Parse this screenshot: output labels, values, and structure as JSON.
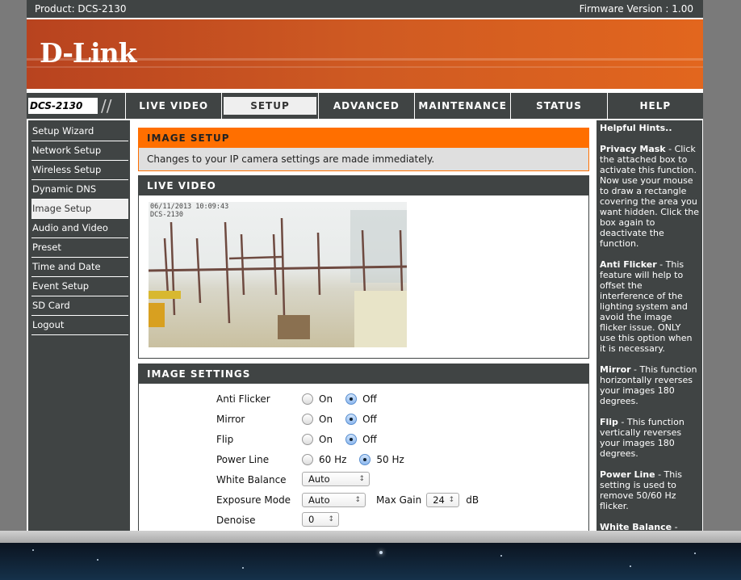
{
  "topbar": {
    "product": "Product: DCS-2130",
    "firmware": "Firmware Version : 1.00"
  },
  "logo": "D-Link",
  "nav": {
    "model": "DCS-2130",
    "tabs": [
      "LIVE VIDEO",
      "SETUP",
      "ADVANCED",
      "MAINTENANCE",
      "STATUS",
      "HELP"
    ],
    "active": "SETUP"
  },
  "sidebar": {
    "items": [
      "Setup Wizard",
      "Network Setup",
      "Wireless Setup",
      "Dynamic DNS",
      "Image Setup",
      "Audio and Video",
      "Preset",
      "Time and Date",
      "Event Setup",
      "SD Card",
      "Logout"
    ],
    "active": "Image Setup"
  },
  "image_setup": {
    "title": "IMAGE SETUP",
    "description": "Changes to your IP camera settings are made immediately."
  },
  "live_video": {
    "title": "LIVE VIDEO",
    "timestamp": "06/11/2013 10:09:43",
    "camera_label": "DCS-2130"
  },
  "image_settings": {
    "title": "IMAGE SETTINGS",
    "anti_flicker": {
      "label": "Anti Flicker",
      "on": "On",
      "off": "Off",
      "selected": "Off"
    },
    "mirror": {
      "label": "Mirror",
      "on": "On",
      "off": "Off",
      "selected": "Off"
    },
    "flip": {
      "label": "Flip",
      "on": "On",
      "off": "Off",
      "selected": "Off"
    },
    "power_line": {
      "label": "Power Line",
      "opt1": "60 Hz",
      "opt2": "50 Hz",
      "selected": "50 Hz"
    },
    "white_balance": {
      "label": "White Balance",
      "value": "Auto"
    },
    "exposure_mode": {
      "label": "Exposure Mode",
      "value": "Auto",
      "max_gain_label": "Max Gain",
      "max_gain": "24",
      "unit": "dB"
    },
    "denoise": {
      "label": "Denoise",
      "value": "0"
    }
  },
  "hints": {
    "title": "Helpful Hints..",
    "items": [
      {
        "term": "Privacy Mask",
        "text": " - Click the attached box to activate this function. Now use your mouse to draw a rectangle covering the area you want hidden. Click the box again to deactivate the function."
      },
      {
        "term": "Anti Flicker",
        "text": " - This feature will help to offset the interference of the lighting system and avoid the image flicker issue. ONLY use this option when it is necessary."
      },
      {
        "term": "Mirror",
        "text": " - This function horizontally reverses your images 180 degrees."
      },
      {
        "term": "Flip",
        "text": " - This function vertically reverses your images 180 degrees."
      },
      {
        "term": "Power Line",
        "text": " - This setting is used to remove 50/60 Hz flicker."
      },
      {
        "term": "White Balance",
        "text": " - White Balance - Is the process of removing unrealistic color casts, so that objects which appear"
      }
    ]
  }
}
